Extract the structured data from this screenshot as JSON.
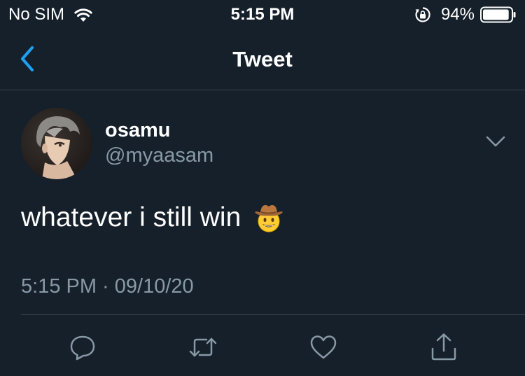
{
  "status_bar": {
    "carrier": "No SIM",
    "time": "5:15 PM",
    "battery_percent": "94%",
    "battery_level": 0.94,
    "icons": [
      "wifi-icon",
      "rotation-lock-icon",
      "battery-icon"
    ]
  },
  "nav": {
    "title": "Tweet",
    "back_icon": "chevron-left-icon"
  },
  "tweet": {
    "display_name": "osamu",
    "handle": "@myaasam",
    "text": "whatever i still win",
    "emoji": "cowboy-hat-face",
    "timestamp": "5:15 PM · 09/10/20",
    "more_icon": "chevron-down-icon"
  },
  "actions": [
    {
      "name": "reply",
      "icon": "reply-icon"
    },
    {
      "name": "retweet",
      "icon": "retweet-icon"
    },
    {
      "name": "like",
      "icon": "heart-icon"
    },
    {
      "name": "share",
      "icon": "share-icon"
    }
  ],
  "colors": {
    "background": "#15202b",
    "accent": "#1da1f2",
    "secondary_text": "#8899a6",
    "divider": "#38444d"
  }
}
